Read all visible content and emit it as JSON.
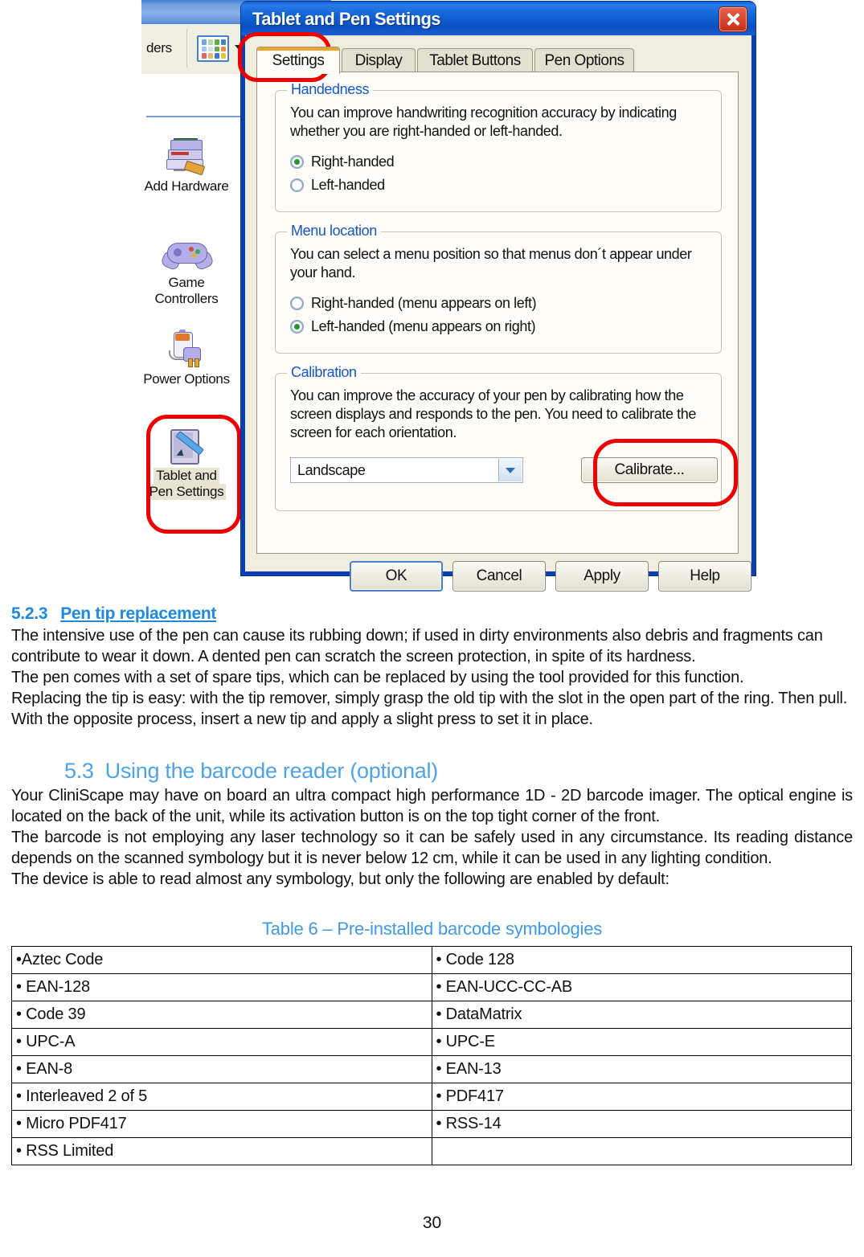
{
  "screenshot": {
    "control_panel": {
      "toolbar_label": "ders",
      "view_icon": "views-grid-icon",
      "items": [
        {
          "label_line1": "Add Hardware",
          "label_line2": "",
          "icon": "add-hardware-icon",
          "selected": false
        },
        {
          "label_line1": "Game",
          "label_line2": "Controllers",
          "icon": "game-controller-icon",
          "selected": false
        },
        {
          "label_line1": "Power Options",
          "label_line2": "",
          "icon": "power-options-icon",
          "selected": false
        },
        {
          "label_line1": "Tablet and",
          "label_line2": "Pen Settings",
          "icon": "tablet-pen-icon",
          "selected": true
        }
      ]
    },
    "dialog": {
      "title": "Tablet and Pen Settings",
      "close_icon": "close-icon",
      "tabs": [
        {
          "label": "Settings",
          "active": true
        },
        {
          "label": "Display",
          "active": false
        },
        {
          "label": "Tablet Buttons",
          "active": false
        },
        {
          "label": "Pen Options",
          "active": false
        }
      ],
      "handedness": {
        "title": "Handedness",
        "description": "You can improve handwriting recognition accuracy by indicating whether you are right-handed or left-handed.",
        "options": [
          {
            "label": "Right-handed",
            "checked": true
          },
          {
            "label": "Left-handed",
            "checked": false
          }
        ]
      },
      "menu_location": {
        "title": "Menu location",
        "description": "You can select a menu position so that menus don´t appear under your hand.",
        "options": [
          {
            "label": "Right-handed (menu appears on left)",
            "checked": false
          },
          {
            "label": "Left-handed (menu appears on right)",
            "checked": true
          }
        ]
      },
      "calibration": {
        "title": "Calibration",
        "description": "You can improve the accuracy of your pen by calibrating how the screen displays and responds to the pen. You need to calibrate the screen for each orientation.",
        "orientation_value": "Landscape",
        "dropdown_icon": "chevron-down-icon",
        "calibrate_button": "Calibrate..."
      },
      "buttons": [
        {
          "label": "OK",
          "default": true
        },
        {
          "label": "Cancel",
          "default": false
        },
        {
          "label": "Apply",
          "default": false
        },
        {
          "label": "Help",
          "default": false
        }
      ],
      "annotation_color": "#ee0000"
    }
  },
  "document": {
    "section_523": {
      "number": "5.2.3",
      "title": "Pen tip replacement",
      "paragraphs": [
        "The intensive use of the pen can cause its rubbing down; if used in dirty environments also debris and fragments can contribute to wear it down.  A dented pen can scratch the screen protection, in spite of its hardness.",
        "The pen comes with a set of spare tips, which can be replaced by using the tool provided for this function.",
        "Replacing the tip is easy: with the tip remover, simply grasp the old tip with the slot in the open part of the ring. Then pull.",
        "With the opposite process, insert a new tip and apply a slight press to set it in place."
      ]
    },
    "section_53": {
      "number": "5.3",
      "title": "Using the  barcode reader (optional)",
      "paragraphs": [
        "Your CliniScape may have on board an ultra compact high performance 1D - 2D barcode imager. The optical engine is located on the back of the unit, while its activation button is on the top tight corner of the front.",
        "The barcode is not employing any laser technology so it can be safely used in any circumstance. Its reading distance depends on the scanned symbology but it is never below 12 cm, while it can be used in any lighting condition.",
        "The device is able to read almost any symbology, but only the following are enabled by default:"
      ]
    },
    "table": {
      "caption": "Table 6 – Pre-installed barcode symbologies",
      "rows": [
        [
          "•Aztec Code",
          "• Code 128"
        ],
        [
          "• EAN-128",
          "• EAN-UCC-CC-AB"
        ],
        [
          "• Code 39",
          "• DataMatrix"
        ],
        [
          "• UPC-A",
          "• UPC-E"
        ],
        [
          "• EAN-8",
          "• EAN-13"
        ],
        [
          "• Interleaved 2 of 5",
          "• PDF417"
        ],
        [
          "• Micro PDF417",
          "• RSS-14"
        ],
        [
          "• RSS Limited",
          ""
        ]
      ]
    },
    "page_number": "30"
  }
}
